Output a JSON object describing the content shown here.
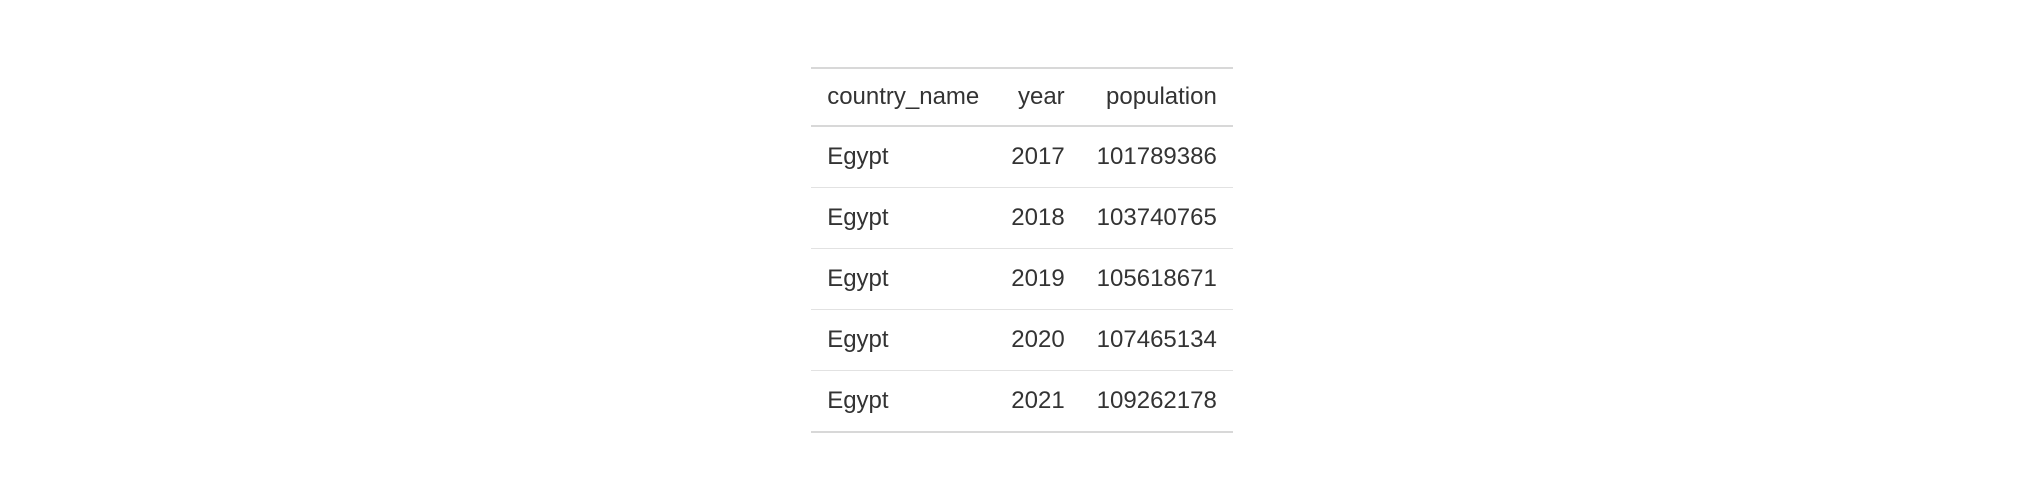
{
  "chart_data": {
    "type": "table",
    "columns": [
      "country_name",
      "year",
      "population"
    ],
    "rows": [
      {
        "country_name": "Egypt",
        "year": 2017,
        "population": 101789386
      },
      {
        "country_name": "Egypt",
        "year": 2018,
        "population": 103740765
      },
      {
        "country_name": "Egypt",
        "year": 2019,
        "population": 105618671
      },
      {
        "country_name": "Egypt",
        "year": 2020,
        "population": 107465134
      },
      {
        "country_name": "Egypt",
        "year": 2021,
        "population": 109262178
      }
    ]
  }
}
